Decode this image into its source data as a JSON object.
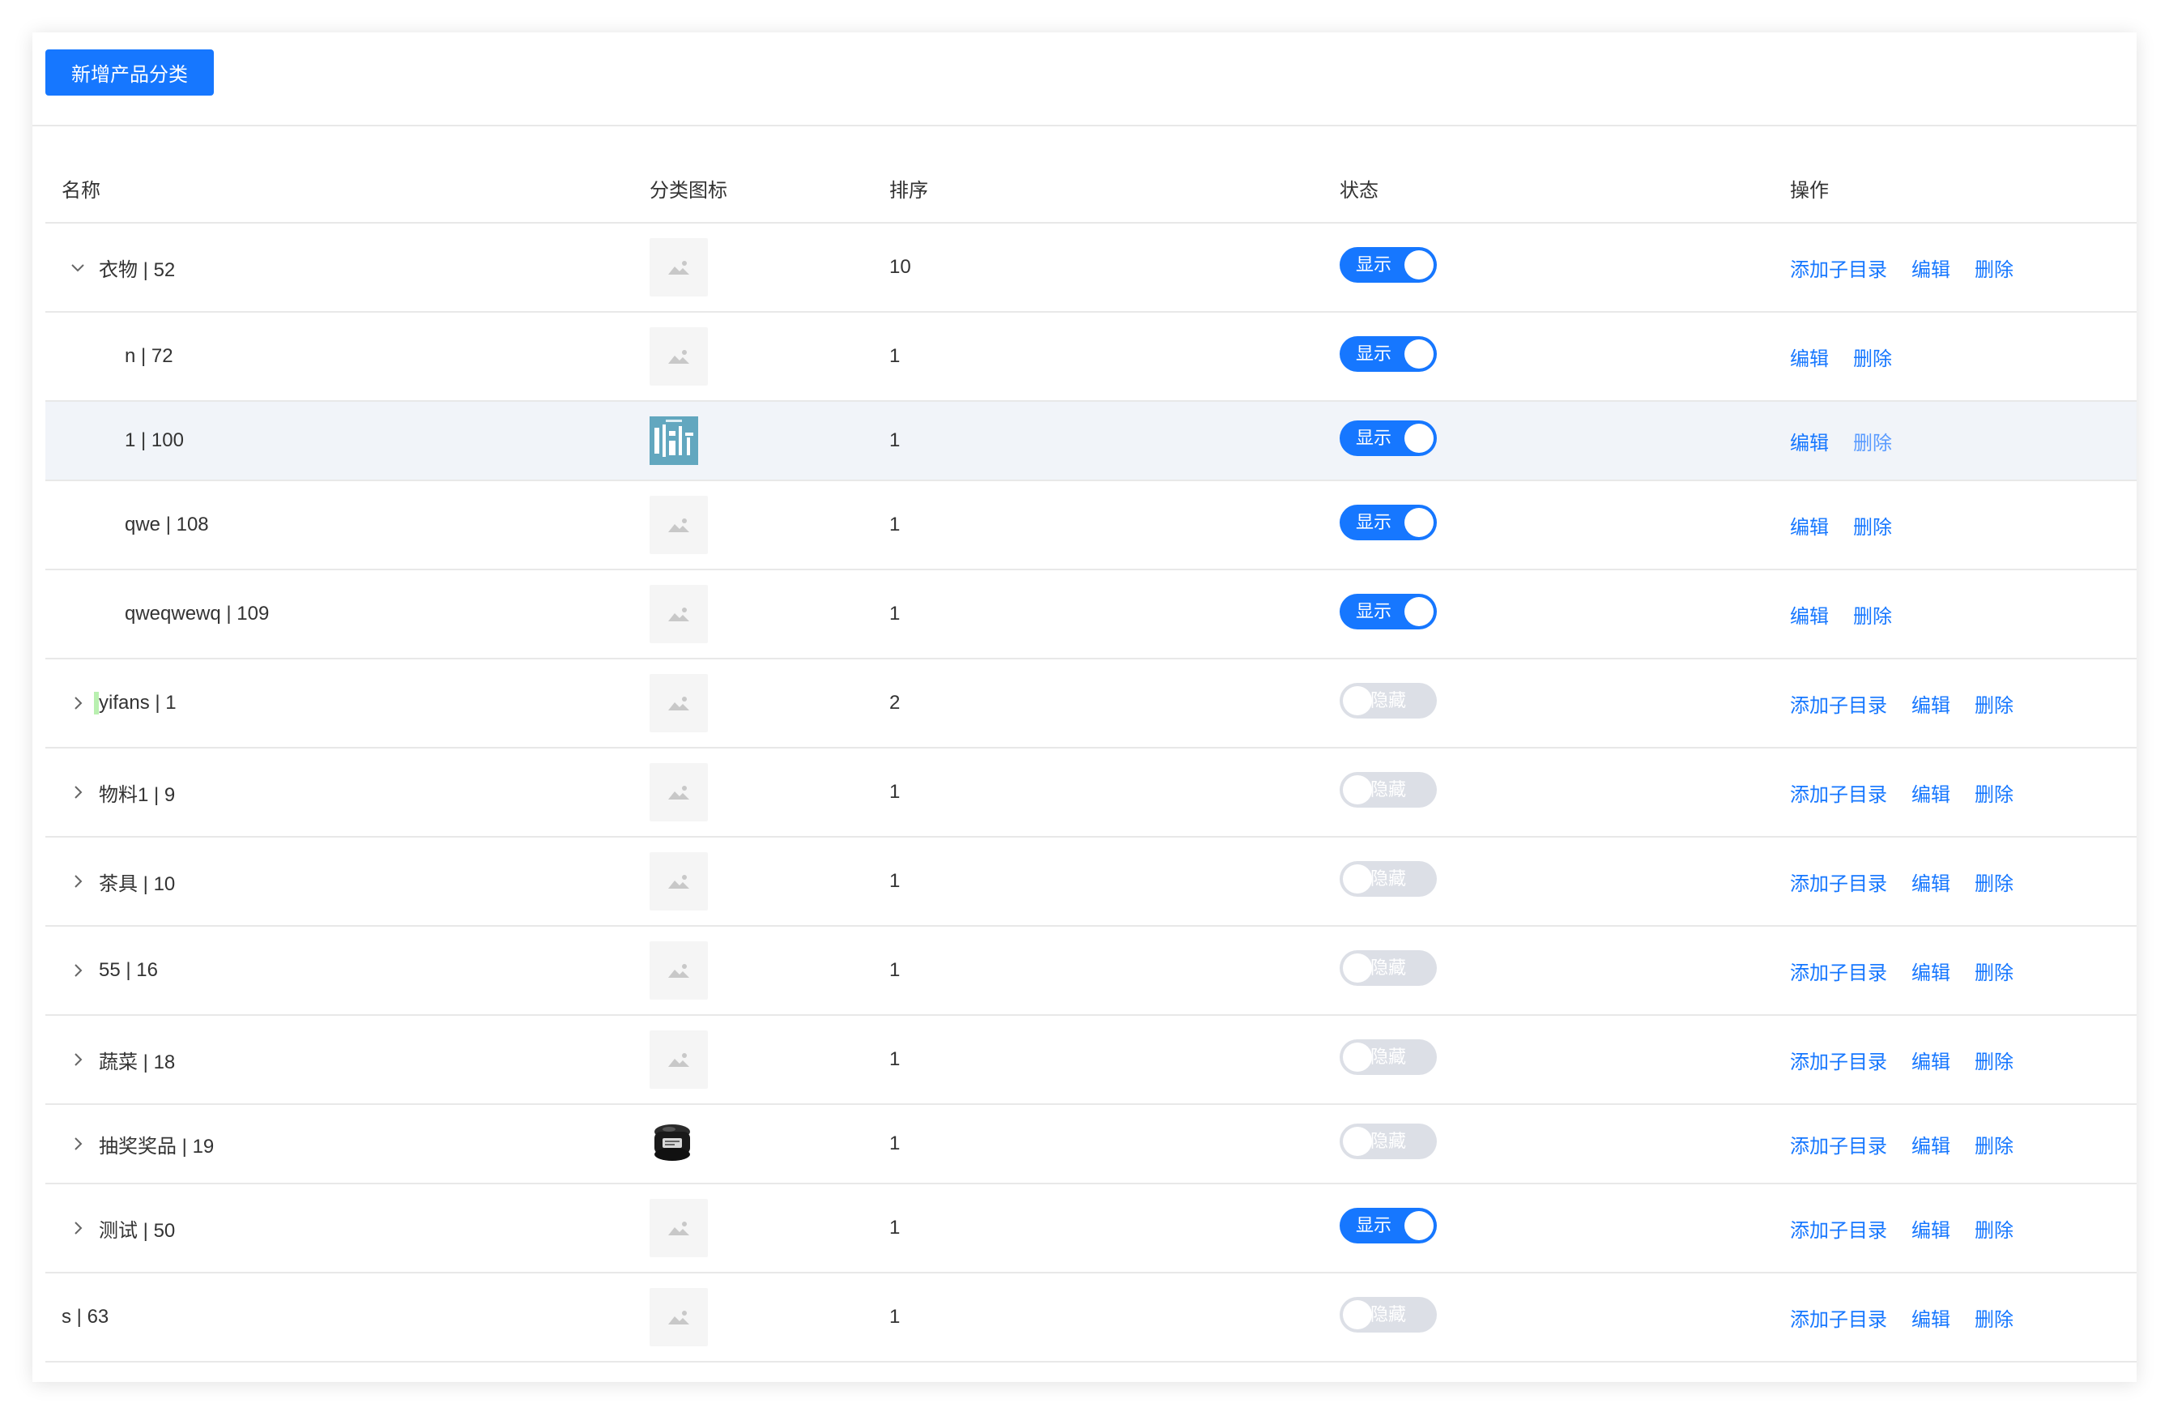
{
  "toolbar": {
    "add_label": "新增产品分类"
  },
  "table": {
    "headers": {
      "name": "名称",
      "icon": "分类图标",
      "sort": "排序",
      "status": "状态",
      "ops": "操作"
    },
    "rows": [
      {
        "name": "衣物 | 52",
        "sort": "10",
        "status": "显示"
      },
      {
        "name": "n | 72",
        "sort": "1",
        "status": "显示"
      },
      {
        "name": "1 | 100",
        "sort": "1",
        "status": "显示"
      },
      {
        "name": "qwe | 108",
        "sort": "1",
        "status": "显示"
      },
      {
        "name": "qweqwewq | 109",
        "sort": "1",
        "status": "显示"
      },
      {
        "name": "yifans | 1",
        "sort": "2",
        "status": "隐藏"
      },
      {
        "name": "物料1 | 9",
        "sort": "1",
        "status": "隐藏"
      },
      {
        "name": "茶具 | 10",
        "sort": "1",
        "status": "隐藏"
      },
      {
        "name": "55 | 16",
        "sort": "1",
        "status": "隐藏"
      },
      {
        "name": "蔬菜 | 18",
        "sort": "1",
        "status": "隐藏"
      },
      {
        "name": "抽奖奖品 | 19",
        "sort": "1",
        "status": "隐藏"
      },
      {
        "name": "测试 | 50",
        "sort": "1",
        "status": "显示"
      },
      {
        "name": "s | 63",
        "sort": "1",
        "status": "隐藏"
      }
    ]
  },
  "actions": {
    "add_child": "添加子目录",
    "edit": "编辑",
    "delete": "删除"
  },
  "icons": {
    "placeholder": "image-placeholder-icon",
    "expanded": "chevron-down-icon",
    "collapsed": "chevron-right-icon"
  },
  "colors": {
    "primary": "#1677ff",
    "switch_off": "#dcdfe6",
    "row_highlight": "#f1f4f9",
    "accent_bar": "#b9f0b0"
  }
}
